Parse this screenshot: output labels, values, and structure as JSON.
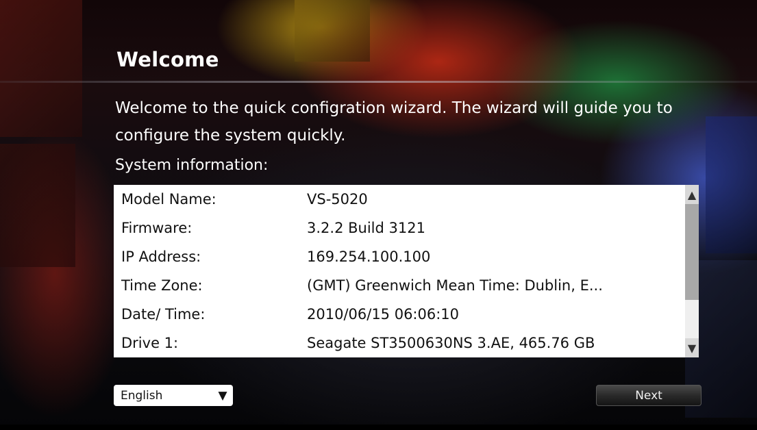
{
  "wizard": {
    "title": "Welcome",
    "intro": "Welcome to the quick configration wizard.  The wizard will guide you to configure the system quickly.",
    "system_info_label": "System information:"
  },
  "system_info": [
    {
      "key": "Model Name:",
      "value": "VS-5020"
    },
    {
      "key": "Firmware:",
      "value": "3.2.2 Build 3121"
    },
    {
      "key": "IP Address:",
      "value": "169.254.100.100"
    },
    {
      "key": "Time Zone:",
      "value": "(GMT) Greenwich Mean Time: Dublin, E..."
    },
    {
      "key": "Date/ Time:",
      "value": "2010/06/15 06:06:10"
    },
    {
      "key": "Drive 1:",
      "value": "Seagate ST3500630NS 3.AE, 465.76 GB"
    }
  ],
  "scrollbar": {
    "up_icon": "triangle-up",
    "down_icon": "triangle-down",
    "up_glyph": "▲",
    "down_glyph": "▼"
  },
  "language": {
    "selected": "English",
    "arrow_glyph": "▼"
  },
  "buttons": {
    "next_label": "Next"
  },
  "colors": {
    "panel_background": "#ffffff",
    "text_on_dark": "#ffffff",
    "scroll_thumb": "#a8a8a8"
  }
}
